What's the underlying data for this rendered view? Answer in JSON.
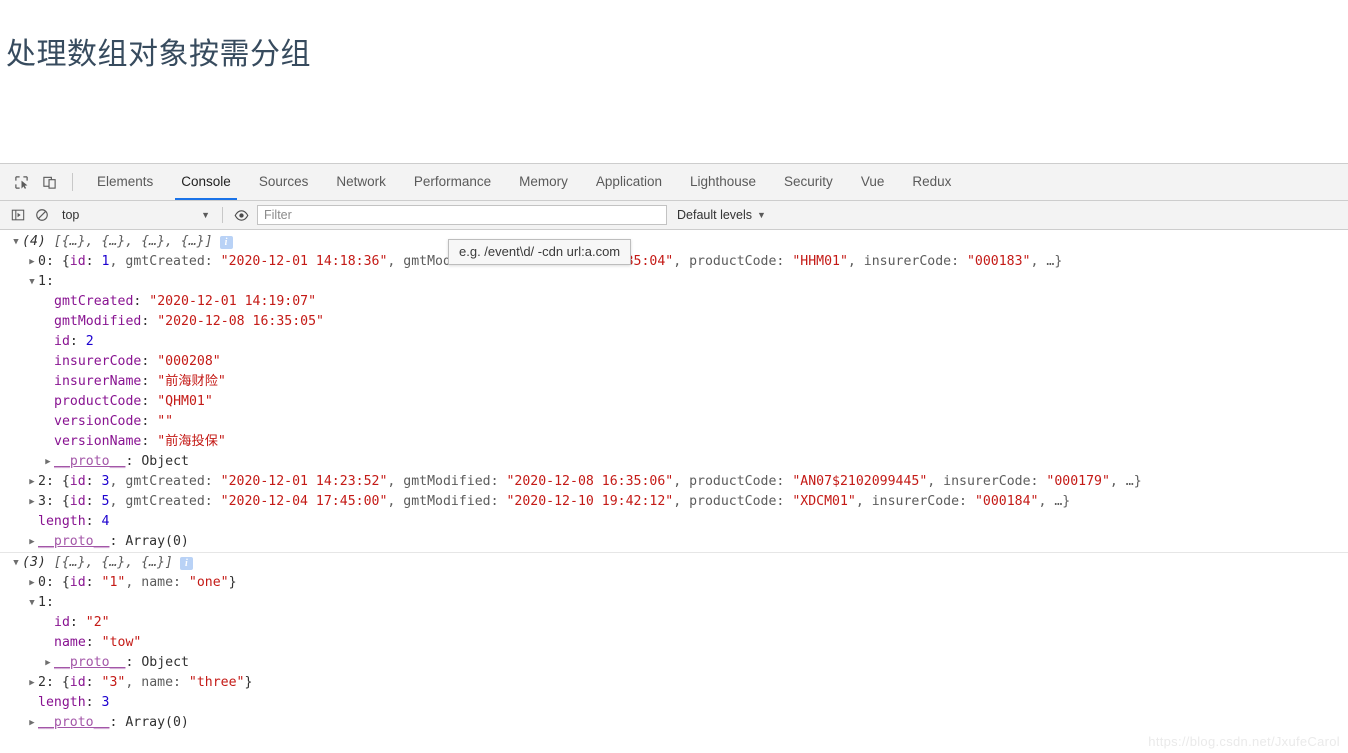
{
  "page": {
    "title": "处理数组对象按需分组",
    "watermark": "https://blog.csdn.net/JxufeCarol"
  },
  "devtools": {
    "icons": {
      "inspect": "inspect-element-icon",
      "device": "device-toolbar-icon",
      "sidebar": "console-sidebar-icon",
      "clear": "clear-console-icon",
      "eye": "live-expression-icon"
    },
    "tabs": [
      {
        "label": "Elements",
        "active": false
      },
      {
        "label": "Console",
        "active": true
      },
      {
        "label": "Sources",
        "active": false
      },
      {
        "label": "Network",
        "active": false
      },
      {
        "label": "Performance",
        "active": false
      },
      {
        "label": "Memory",
        "active": false
      },
      {
        "label": "Application",
        "active": false
      },
      {
        "label": "Lighthouse",
        "active": false
      },
      {
        "label": "Security",
        "active": false
      },
      {
        "label": "Vue",
        "active": false
      },
      {
        "label": "Redux",
        "active": false
      }
    ],
    "toolbar": {
      "context": "top",
      "context_caret": "▼",
      "filter_placeholder": "Filter",
      "filter_value": "",
      "levels_label": "Default levels",
      "levels_caret": "▼"
    },
    "tooltip": "e.g. /event\\d/ -cdn url:a.com"
  },
  "console": {
    "groups": [
      {
        "header": {
          "toggle": "▼",
          "count": "(4)",
          "preview": "[{…}, {…}, {…}, {…}]",
          "badge": "i"
        },
        "rows": [
          {
            "toggle": "▶",
            "indent": 1,
            "segments": [
              {
                "t": "0: {",
                "c": "v-plain"
              },
              {
                "t": "id",
                "c": "k-prop"
              },
              {
                "t": ": ",
                "c": "v-plain"
              },
              {
                "t": "1",
                "c": "v-num"
              },
              {
                "t": ", gmtCreated: ",
                "c": "v-dim"
              },
              {
                "t": "\"2020-12-01 14:18:36\"",
                "c": "v-str"
              },
              {
                "t": ", gmtModified: ",
                "c": "v-dim"
              },
              {
                "t": "\"2020-12-08 16:35:04\"",
                "c": "v-str"
              },
              {
                "t": ", productCode: ",
                "c": "v-dim"
              },
              {
                "t": "\"HHM01\"",
                "c": "v-str"
              },
              {
                "t": ", insurerCode: ",
                "c": "v-dim"
              },
              {
                "t": "\"000183\"",
                "c": "v-str"
              },
              {
                "t": ", …}",
                "c": "v-dim"
              }
            ]
          },
          {
            "toggle": "▼",
            "indent": 1,
            "segments": [
              {
                "t": "1:",
                "c": "v-plain"
              }
            ]
          },
          {
            "toggle": "",
            "indent": 2,
            "segments": [
              {
                "t": "gmtCreated",
                "c": "k-prop"
              },
              {
                "t": ": ",
                "c": "v-plain"
              },
              {
                "t": "\"2020-12-01 14:19:07\"",
                "c": "v-str"
              }
            ]
          },
          {
            "toggle": "",
            "indent": 2,
            "segments": [
              {
                "t": "gmtModified",
                "c": "k-prop"
              },
              {
                "t": ": ",
                "c": "v-plain"
              },
              {
                "t": "\"2020-12-08 16:35:05\"",
                "c": "v-str"
              }
            ]
          },
          {
            "toggle": "",
            "indent": 2,
            "segments": [
              {
                "t": "id",
                "c": "k-prop"
              },
              {
                "t": ": ",
                "c": "v-plain"
              },
              {
                "t": "2",
                "c": "v-num"
              }
            ]
          },
          {
            "toggle": "",
            "indent": 2,
            "segments": [
              {
                "t": "insurerCode",
                "c": "k-prop"
              },
              {
                "t": ": ",
                "c": "v-plain"
              },
              {
                "t": "\"000208\"",
                "c": "v-str"
              }
            ]
          },
          {
            "toggle": "",
            "indent": 2,
            "segments": [
              {
                "t": "insurerName",
                "c": "k-prop"
              },
              {
                "t": ": ",
                "c": "v-plain"
              },
              {
                "t": "\"前海财险\"",
                "c": "v-str"
              }
            ]
          },
          {
            "toggle": "",
            "indent": 2,
            "segments": [
              {
                "t": "productCode",
                "c": "k-prop"
              },
              {
                "t": ": ",
                "c": "v-plain"
              },
              {
                "t": "\"QHM01\"",
                "c": "v-str"
              }
            ]
          },
          {
            "toggle": "",
            "indent": 2,
            "segments": [
              {
                "t": "versionCode",
                "c": "k-prop"
              },
              {
                "t": ": ",
                "c": "v-plain"
              },
              {
                "t": "\"\"",
                "c": "v-str"
              }
            ]
          },
          {
            "toggle": "",
            "indent": 2,
            "segments": [
              {
                "t": "versionName",
                "c": "k-prop"
              },
              {
                "t": ": ",
                "c": "v-plain"
              },
              {
                "t": "\"前海投保\"",
                "c": "v-str"
              }
            ]
          },
          {
            "toggle": "▶",
            "indent": 2,
            "segments": [
              {
                "t": "__proto__",
                "c": "k-proto"
              },
              {
                "t": ": Object",
                "c": "v-plain"
              }
            ]
          },
          {
            "toggle": "▶",
            "indent": 1,
            "segments": [
              {
                "t": "2: {",
                "c": "v-plain"
              },
              {
                "t": "id",
                "c": "k-prop"
              },
              {
                "t": ": ",
                "c": "v-plain"
              },
              {
                "t": "3",
                "c": "v-num"
              },
              {
                "t": ", gmtCreated: ",
                "c": "v-dim"
              },
              {
                "t": "\"2020-12-01 14:23:52\"",
                "c": "v-str"
              },
              {
                "t": ", gmtModified: ",
                "c": "v-dim"
              },
              {
                "t": "\"2020-12-08 16:35:06\"",
                "c": "v-str"
              },
              {
                "t": ", productCode: ",
                "c": "v-dim"
              },
              {
                "t": "\"AN07$2102099445\"",
                "c": "v-str"
              },
              {
                "t": ", insurerCode: ",
                "c": "v-dim"
              },
              {
                "t": "\"000179\"",
                "c": "v-str"
              },
              {
                "t": ", …}",
                "c": "v-dim"
              }
            ]
          },
          {
            "toggle": "▶",
            "indent": 1,
            "segments": [
              {
                "t": "3: {",
                "c": "v-plain"
              },
              {
                "t": "id",
                "c": "k-prop"
              },
              {
                "t": ": ",
                "c": "v-plain"
              },
              {
                "t": "5",
                "c": "v-num"
              },
              {
                "t": ", gmtCreated: ",
                "c": "v-dim"
              },
              {
                "t": "\"2020-12-04 17:45:00\"",
                "c": "v-str"
              },
              {
                "t": ", gmtModified: ",
                "c": "v-dim"
              },
              {
                "t": "\"2020-12-10 19:42:12\"",
                "c": "v-str"
              },
              {
                "t": ", productCode: ",
                "c": "v-dim"
              },
              {
                "t": "\"XDCM01\"",
                "c": "v-str"
              },
              {
                "t": ", insurerCode: ",
                "c": "v-dim"
              },
              {
                "t": "\"000184\"",
                "c": "v-str"
              },
              {
                "t": ", …}",
                "c": "v-dim"
              }
            ]
          },
          {
            "toggle": "",
            "indent": 1,
            "segments": [
              {
                "t": "length",
                "c": "k-prop"
              },
              {
                "t": ": ",
                "c": "v-plain"
              },
              {
                "t": "4",
                "c": "v-num"
              }
            ]
          },
          {
            "toggle": "▶",
            "indent": 1,
            "segments": [
              {
                "t": "__proto__",
                "c": "k-proto"
              },
              {
                "t": ": Array(0)",
                "c": "v-plain"
              }
            ]
          }
        ]
      },
      {
        "header": {
          "toggle": "▼",
          "count": "(3)",
          "preview": "[{…}, {…}, {…}]",
          "badge": "i"
        },
        "rows": [
          {
            "toggle": "▶",
            "indent": 1,
            "segments": [
              {
                "t": "0: {",
                "c": "v-plain"
              },
              {
                "t": "id",
                "c": "k-prop"
              },
              {
                "t": ": ",
                "c": "v-plain"
              },
              {
                "t": "\"1\"",
                "c": "v-str"
              },
              {
                "t": ", name: ",
                "c": "v-dim"
              },
              {
                "t": "\"one\"",
                "c": "v-str"
              },
              {
                "t": "}",
                "c": "v-plain"
              }
            ]
          },
          {
            "toggle": "▼",
            "indent": 1,
            "segments": [
              {
                "t": "1:",
                "c": "v-plain"
              }
            ]
          },
          {
            "toggle": "",
            "indent": 2,
            "segments": [
              {
                "t": "id",
                "c": "k-prop"
              },
              {
                "t": ": ",
                "c": "v-plain"
              },
              {
                "t": "\"2\"",
                "c": "v-str"
              }
            ]
          },
          {
            "toggle": "",
            "indent": 2,
            "segments": [
              {
                "t": "name",
                "c": "k-prop"
              },
              {
                "t": ": ",
                "c": "v-plain"
              },
              {
                "t": "\"tow\"",
                "c": "v-str"
              }
            ]
          },
          {
            "toggle": "▶",
            "indent": 2,
            "segments": [
              {
                "t": "__proto__",
                "c": "k-proto"
              },
              {
                "t": ": Object",
                "c": "v-plain"
              }
            ]
          },
          {
            "toggle": "▶",
            "indent": 1,
            "segments": [
              {
                "t": "2: {",
                "c": "v-plain"
              },
              {
                "t": "id",
                "c": "k-prop"
              },
              {
                "t": ": ",
                "c": "v-plain"
              },
              {
                "t": "\"3\"",
                "c": "v-str"
              },
              {
                "t": ", name: ",
                "c": "v-dim"
              },
              {
                "t": "\"three\"",
                "c": "v-str"
              },
              {
                "t": "}",
                "c": "v-plain"
              }
            ]
          },
          {
            "toggle": "",
            "indent": 1,
            "segments": [
              {
                "t": "length",
                "c": "k-prop"
              },
              {
                "t": ": ",
                "c": "v-plain"
              },
              {
                "t": "3",
                "c": "v-num"
              }
            ]
          },
          {
            "toggle": "▶",
            "indent": 1,
            "segments": [
              {
                "t": "__proto__",
                "c": "k-proto"
              },
              {
                "t": ": Array(0)",
                "c": "v-plain"
              }
            ]
          }
        ]
      }
    ]
  }
}
